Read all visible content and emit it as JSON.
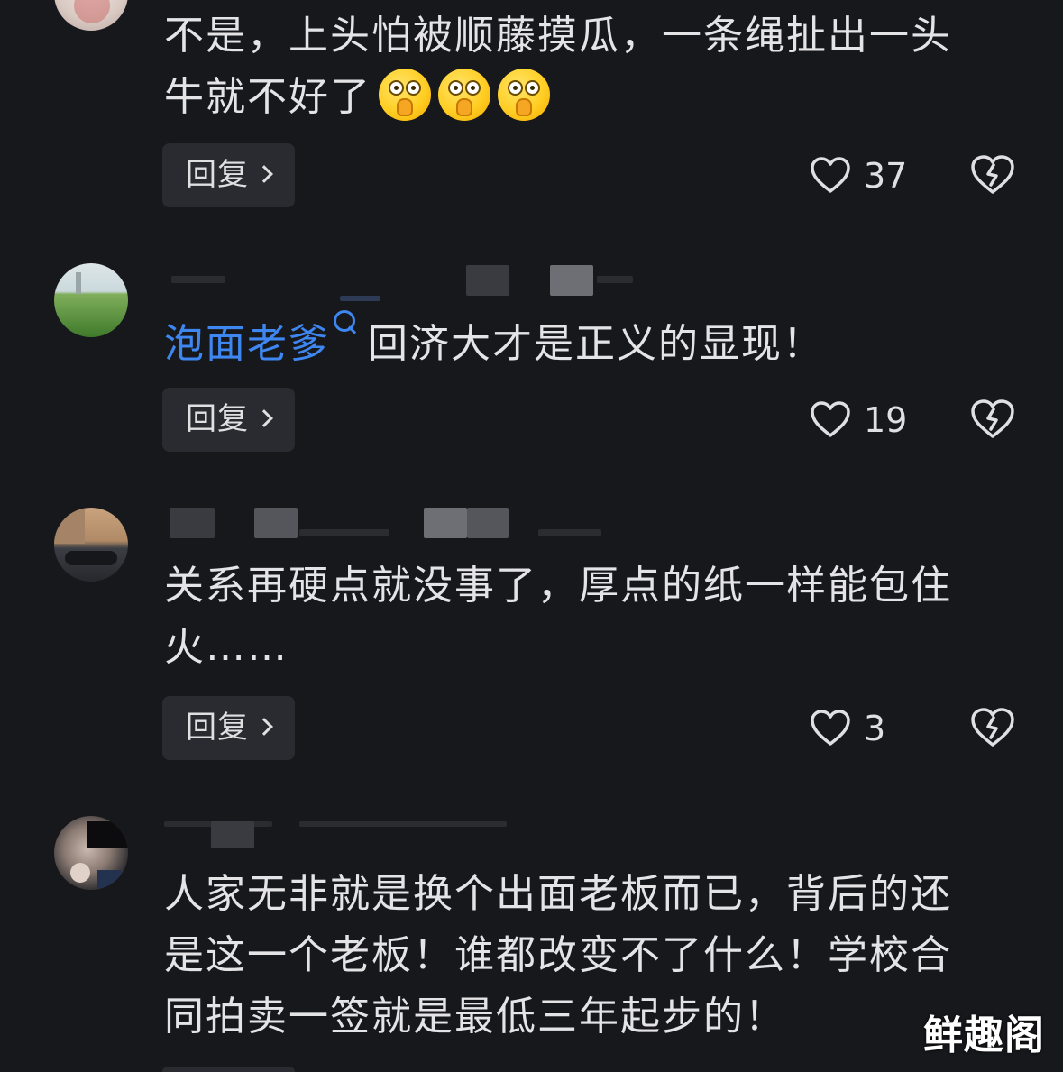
{
  "comments": [
    {
      "text_lines": [
        "不是，上头怕被顺藤摸瓜，一条绳扯出一头",
        "牛就不好了"
      ],
      "emoji_name": "hand-over-mouth-emoji",
      "reply_label": "回复",
      "like_count": "37"
    },
    {
      "mention": "泡面老爹",
      "text": "回济大才是正义的显现！",
      "reply_label": "回复",
      "like_count": "19"
    },
    {
      "text_lines": [
        "关系再硬点就没事了，厚点的纸一样能包住",
        "火……"
      ],
      "reply_label": "回复",
      "like_count": "3"
    },
    {
      "text_lines": [
        "人家无非就是换个出面老板而已，背后的还",
        "是这一个老板！谁都改变不了什么！学校合",
        "同拍卖一签就是最低三年起步的！"
      ]
    }
  ],
  "watermark": "鲜趣阁",
  "colors": {
    "background": "#17181c",
    "text": "#e4e4e6",
    "mention": "#3e86f0",
    "button_bg": "#2a2b30"
  },
  "icons": [
    "heart-outline-icon",
    "broken-heart-icon",
    "chevron-right-icon",
    "search-icon"
  ]
}
